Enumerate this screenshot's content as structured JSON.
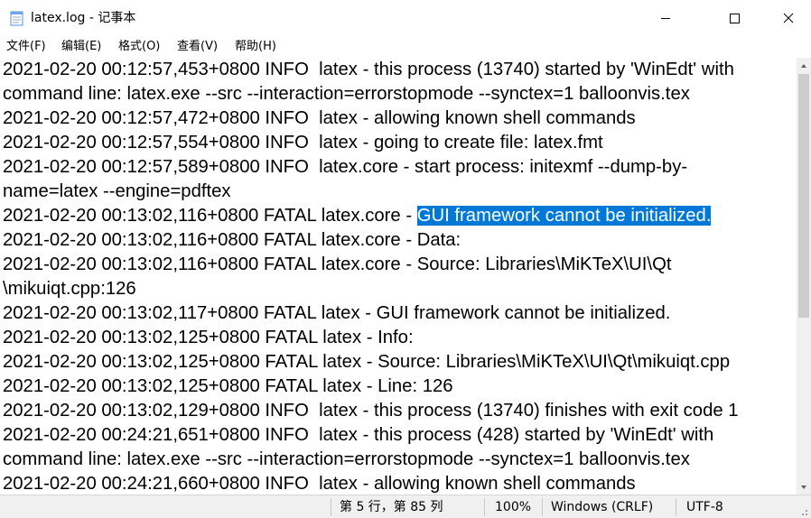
{
  "window": {
    "title": "latex.log - 记事本",
    "icon": "notepad-icon",
    "controls": [
      "minimize-icon",
      "maximize-icon",
      "close-icon"
    ]
  },
  "menu": [
    "文件(F)",
    "编辑(E)",
    "格式(O)",
    "查看(V)",
    "帮助(H)"
  ],
  "lines": [
    {
      "text": "2021-02-20 00:12:57,453+0800 INFO  latex - this process (13740) started by 'WinEdt' with"
    },
    {
      "text": "command line: latex.exe --src --interaction=errorstopmode --synctex=1 balloonvis.tex"
    },
    {
      "text": "2021-02-20 00:12:57,472+0800 INFO  latex - allowing known shell commands"
    },
    {
      "text": "2021-02-20 00:12:57,554+0800 INFO  latex - going to create file: latex.fmt"
    },
    {
      "text": "2021-02-20 00:12:57,589+0800 INFO  latex.core - start process: initexmf --dump-by-"
    },
    {
      "text": "name=latex --engine=pdftex"
    },
    {
      "text": "2021-02-20 00:13:02,116+0800 FATAL latex.core - ",
      "selected": "GUI framework cannot be initialized."
    },
    {
      "text": "2021-02-20 00:13:02,116+0800 FATAL latex.core - Data:"
    },
    {
      "text": "2021-02-20 00:13:02,116+0800 FATAL latex.core - Source: Libraries\\MiKTeX\\UI\\Qt"
    },
    {
      "text": "\\mikuiqt.cpp:126"
    },
    {
      "text": "2021-02-20 00:13:02,117+0800 FATAL latex - GUI framework cannot be initialized."
    },
    {
      "text": "2021-02-20 00:13:02,125+0800 FATAL latex - Info:"
    },
    {
      "text": "2021-02-20 00:13:02,125+0800 FATAL latex - Source: Libraries\\MiKTeX\\UI\\Qt\\mikuiqt.cpp"
    },
    {
      "text": "2021-02-20 00:13:02,125+0800 FATAL latex - Line: 126"
    },
    {
      "text": "2021-02-20 00:13:02,129+0800 INFO  latex - this process (13740) finishes with exit code 1"
    },
    {
      "text": "2021-02-20 00:24:21,651+0800 INFO  latex - this process (428) started by 'WinEdt' with"
    },
    {
      "text": "command line: latex.exe --src --interaction=errorstopmode --synctex=1 balloonvis.tex"
    },
    {
      "text": "2021-02-20 00:24:21,660+0800 INFO  latex - allowing known shell commands"
    }
  ],
  "status": {
    "position": "第 5 行，第 85 列",
    "zoom": "100%",
    "line_ending": "Windows (CRLF)",
    "encoding": "UTF-8"
  },
  "colors": {
    "selection_bg": "#0078d7",
    "selection_fg": "#ffffff",
    "statusbar_bg": "#f0f0f0"
  }
}
